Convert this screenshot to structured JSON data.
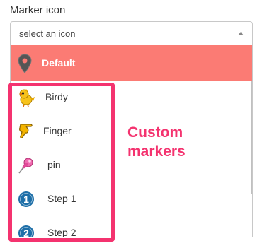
{
  "field": {
    "label": "Marker icon",
    "placeholder": "select an icon"
  },
  "dropdown": {
    "default_option": {
      "label": "Default",
      "icon": "map-pin-icon"
    },
    "options": [
      {
        "label": "Birdy",
        "icon": "bird-icon"
      },
      {
        "label": "Finger",
        "icon": "pointing-finger-icon"
      },
      {
        "label": "pin",
        "icon": "pushpin-icon"
      },
      {
        "label": "Step 1",
        "icon": "step-1-badge-icon"
      },
      {
        "label": "Step 2",
        "icon": "step-2-badge-icon"
      }
    ]
  },
  "annotation": {
    "line1": "Custom",
    "line2": "markers"
  },
  "colors": {
    "default_highlight": "#fb7b74",
    "annotation": "#f4336f",
    "step_badge": "#1e6fa8"
  }
}
